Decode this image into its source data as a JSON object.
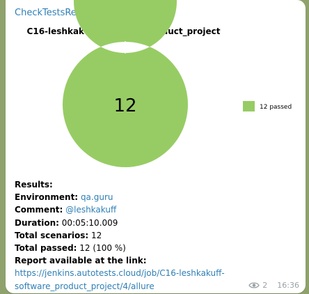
{
  "message": {
    "sender": "CheckTestsReports",
    "time": "16:36",
    "views": "2"
  },
  "chart_data": {
    "type": "pie",
    "title": "C16-leshkakuff-software_product_project",
    "center_label": "12",
    "slices": [
      {
        "label": "12 passed",
        "value": 12,
        "color": "#97cc64"
      }
    ],
    "legend_position": "right"
  },
  "results": {
    "header": "Results:",
    "environment_label": "Environment:",
    "environment_value": "qa.guru",
    "comment_label": "Comment:",
    "comment_value": "@leshkakuff",
    "duration_label": "Duration:",
    "duration_value": "00:05:10.009",
    "total_scenarios_label": "Total scenarios:",
    "total_scenarios_value": "12",
    "total_passed_label": "Total passed:",
    "total_passed_value": "12 (100 %)",
    "report_label": "Report available at the link:",
    "report_link_line1": "https://jenkins.autotests.cloud/job/C16-leshkakuff-",
    "report_link_line2": "software_product_project/4/allure"
  },
  "colors": {
    "link": "#2f7fb6",
    "passed": "#97cc64",
    "background": "#8fa26d"
  }
}
